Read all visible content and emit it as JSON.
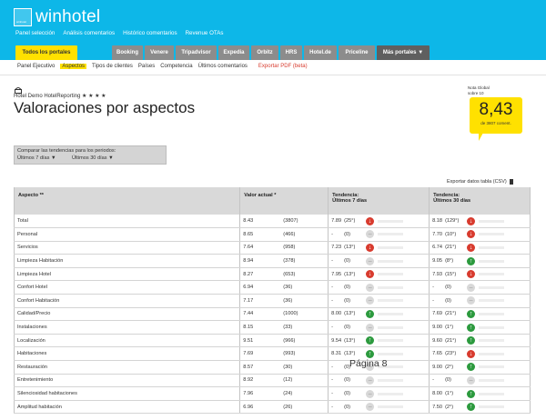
{
  "brand": {
    "name": "winhotel",
    "box_label": "winhotel"
  },
  "topnav": [
    "Panel selección",
    "Análisis comentarios",
    "Histórico comentarios",
    "Revenue OTAs"
  ],
  "tabs": {
    "active": "Todos los portales",
    "items": [
      "Booking",
      "Venere",
      "Tripadvisor",
      "Expedia",
      "Orbitz",
      "HRS",
      "Hotel.de",
      "Priceline"
    ],
    "more": "Más portales ▼"
  },
  "subnav": {
    "items": [
      "Panel Ejecutivo",
      "Aspectos",
      "Tipos de clientes",
      "Países",
      "Competencia",
      "Últimos comentarios"
    ],
    "pdf": "Exportar PDF (beta)"
  },
  "hotel_line": "Hotel Demo HotelReporting ★ ★ ★ ★",
  "page_title": "Valoraciones por aspectos",
  "score": {
    "label_line1": "Nota Global",
    "label_line2": "sobre 10",
    "value": "8,43",
    "count": "de 3807 coment."
  },
  "compare": {
    "title": "Comparar las tendencias para los periodos:",
    "opt1": "Últimos 7 días ▼",
    "opt2": "Últimos 30 días ▼"
  },
  "export_label": "Exportar datos tabla (CSV)",
  "table": {
    "headers": {
      "aspect": "Aspecto **",
      "value": "Valor actual *",
      "t7_l1": "Tendencia:",
      "t7_l2": "Últimos 7 días",
      "t30_l1": "Tendencia:",
      "t30_l2": "Últimos 30 días"
    },
    "rows": [
      {
        "aspect": "Total",
        "score": "8.43",
        "count": "(3807)",
        "t7": "7.89",
        "t7c": "(25°)",
        "t7d": "down",
        "t30": "8.18",
        "t30c": "(129°)",
        "t30d": "down"
      },
      {
        "aspect": "Personal",
        "score": "8.65",
        "count": "(466)",
        "t7": "-",
        "t7c": "(0)",
        "t7d": "flat",
        "t30": "7.70",
        "t30c": "(10°)",
        "t30d": "down"
      },
      {
        "aspect": "Servicios",
        "score": "7.64",
        "count": "(958)",
        "t7": "7.23",
        "t7c": "(13°)",
        "t7d": "down",
        "t30": "6.74",
        "t30c": "(21°)",
        "t30d": "down"
      },
      {
        "aspect": "Limpieza Habitación",
        "score": "8.94",
        "count": "(378)",
        "t7": "-",
        "t7c": "(0)",
        "t7d": "flat",
        "t30": "9.05",
        "t30c": "(8°)",
        "t30d": "up"
      },
      {
        "aspect": "Limpieza Hotel",
        "score": "8.27",
        "count": "(653)",
        "t7": "7.95",
        "t7c": "(13°)",
        "t7d": "down",
        "t30": "7.93",
        "t30c": "(15°)",
        "t30d": "down"
      },
      {
        "aspect": "Confort Hotel",
        "score": "6.94",
        "count": "(36)",
        "t7": "-",
        "t7c": "(0)",
        "t7d": "flat",
        "t30": "-",
        "t30c": "(0)",
        "t30d": "flat"
      },
      {
        "aspect": "Confort Habitación",
        "score": "7.17",
        "count": "(36)",
        "t7": "-",
        "t7c": "(0)",
        "t7d": "flat",
        "t30": "-",
        "t30c": "(0)",
        "t30d": "flat"
      },
      {
        "aspect": "Calidad/Precio",
        "score": "7.44",
        "count": "(1000)",
        "t7": "8.00",
        "t7c": "(13°)",
        "t7d": "up",
        "t30": "7.69",
        "t30c": "(21°)",
        "t30d": "up"
      },
      {
        "aspect": "Instalaciones",
        "score": "8.15",
        "count": "(33)",
        "t7": "-",
        "t7c": "(0)",
        "t7d": "flat",
        "t30": "9.00",
        "t30c": "(1°)",
        "t30d": "up"
      },
      {
        "aspect": "Localización",
        "score": "9.51",
        "count": "(966)",
        "t7": "9.54",
        "t7c": "(13°)",
        "t7d": "up",
        "t30": "9.60",
        "t30c": "(21°)",
        "t30d": "up"
      },
      {
        "aspect": "Habitaciones",
        "score": "7.69",
        "count": "(993)",
        "t7": "8.31",
        "t7c": "(13°)",
        "t7d": "up",
        "t30": "7.65",
        "t30c": "(23°)",
        "t30d": "down"
      },
      {
        "aspect": "Restauración",
        "score": "8.57",
        "count": "(30)",
        "t7": "-",
        "t7c": "(0)",
        "t7d": "flat",
        "t30": "9.00",
        "t30c": "(2°)",
        "t30d": "up"
      },
      {
        "aspect": "Entretenimiento",
        "score": "8.92",
        "count": "(12)",
        "t7": "-",
        "t7c": "(0)",
        "t7d": "flat",
        "t30": "-",
        "t30c": "(0)",
        "t30d": "flat"
      },
      {
        "aspect": "Silenciosidad habitaciones",
        "score": "7.96",
        "count": "(24)",
        "t7": "-",
        "t7c": "(0)",
        "t7d": "flat",
        "t30": "8.00",
        "t30c": "(1°)",
        "t30d": "up"
      },
      {
        "aspect": "Amplitud habitación",
        "score": "6.96",
        "count": "(26)",
        "t7": "-",
        "t7c": "(0)",
        "t7d": "flat",
        "t30": "7.50",
        "t30c": "(2°)",
        "t30d": "up"
      }
    ]
  },
  "watermark": "Página 8",
  "colors": {
    "header_blue": "#0db7e8",
    "accent_yellow": "#ffe100",
    "tab_gray": "#8c8c8c",
    "down_red": "#d83b2e",
    "up_green": "#2c9a3e"
  }
}
